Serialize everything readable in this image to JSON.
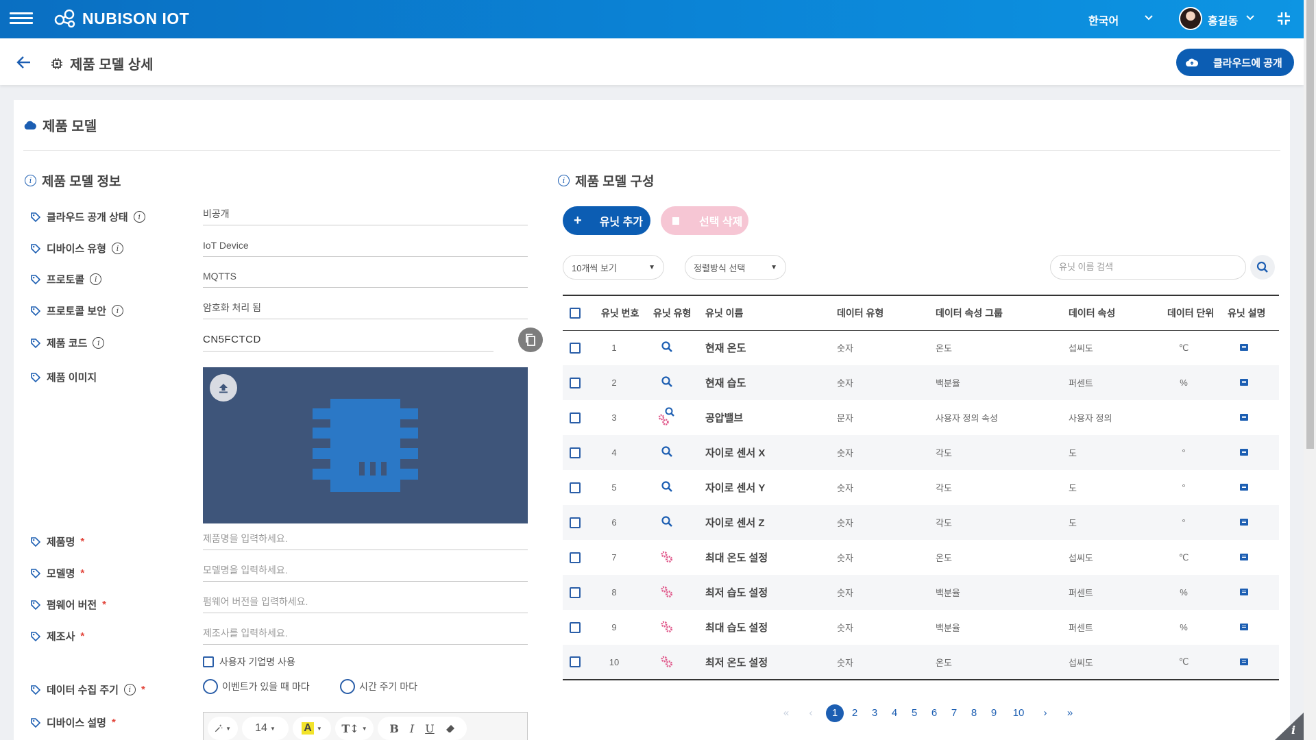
{
  "app": {
    "logo_text": "NUBISON IOT",
    "language": "한국어",
    "user_name": "홍길동"
  },
  "header": {
    "title": "제품 모델 상세",
    "publish_label": "클라우드에 공개"
  },
  "card": {
    "title": "제품 모델"
  },
  "info_section": {
    "title": "제품 모델 정보",
    "fields": [
      {
        "label": "클라우드 공개 상태",
        "value": "비공개"
      },
      {
        "label": "디바이스 유형",
        "value": "IoT Device"
      },
      {
        "label": "프로토콜",
        "value": "MQTTS"
      },
      {
        "label": "프로토콜 보안",
        "value": "암호화 처리 됨"
      },
      {
        "label": "제품 코드",
        "value": "CN5FCTCD"
      },
      {
        "label": "제품 이미지"
      },
      {
        "label": "제품명",
        "required": "*",
        "placeholder": "제품명을 입력하세요."
      },
      {
        "label": "모델명",
        "required": "*",
        "placeholder": "모델명을 입력하세요."
      },
      {
        "label": "펌웨어 버전",
        "required": "*",
        "placeholder": "펌웨어 버전을 입력하세요."
      },
      {
        "label": "제조사",
        "required": "*",
        "placeholder": "제조사를 입력하세요."
      },
      {
        "label": "데이터 수집 주기",
        "required": "*"
      },
      {
        "label": "디바이스 설명",
        "required": "*"
      }
    ],
    "custom_company_label": "사용자 기업명 사용",
    "radio_event": "이벤트가 있을 때 마다",
    "radio_time": "시간 주기 마다",
    "editor_font_size": "14"
  },
  "config_section": {
    "title": "제품 모델 구성",
    "add_unit_label": "유닛 추가",
    "delete_selected_label": "선택 삭제",
    "page_size_label": "10개씩 보기",
    "sort_label": "정렬방식 선택",
    "search_placeholder": "유닛 이름 검색",
    "columns": [
      "유닛 번호",
      "유닛 유형",
      "유닛 이름",
      "데이터 유형",
      "데이터 속성 그룹",
      "데이터 속성",
      "데이터 단위",
      "유닛 설명"
    ],
    "rows": [
      {
        "no": "1",
        "type_icon": "sensor",
        "name": "현재 온도",
        "data_type": "숫자",
        "group": "온도",
        "attr": "섭씨도",
        "unit": "℃"
      },
      {
        "no": "2",
        "type_icon": "sensor",
        "name": "현재 습도",
        "data_type": "숫자",
        "group": "백분율",
        "attr": "퍼센트",
        "unit": "%"
      },
      {
        "no": "3",
        "type_icon": "sensor-actuator",
        "name": "공압밸브",
        "data_type": "문자",
        "group": "사용자 정의 속성",
        "attr": "사용자 정의",
        "unit": ""
      },
      {
        "no": "4",
        "type_icon": "sensor",
        "name": "자이로 센서 X",
        "data_type": "숫자",
        "group": "각도",
        "attr": "도",
        "unit": "°"
      },
      {
        "no": "5",
        "type_icon": "sensor",
        "name": "자이로 센서 Y",
        "data_type": "숫자",
        "group": "각도",
        "attr": "도",
        "unit": "°"
      },
      {
        "no": "6",
        "type_icon": "sensor",
        "name": "자이로 센서 Z",
        "data_type": "숫자",
        "group": "각도",
        "attr": "도",
        "unit": "°"
      },
      {
        "no": "7",
        "type_icon": "actuator",
        "name": "최대 온도 설정",
        "data_type": "숫자",
        "group": "온도",
        "attr": "섭씨도",
        "unit": "℃"
      },
      {
        "no": "8",
        "type_icon": "actuator",
        "name": "최저 습도 설정",
        "data_type": "숫자",
        "group": "백분율",
        "attr": "퍼센트",
        "unit": "%"
      },
      {
        "no": "9",
        "type_icon": "actuator",
        "name": "최대 습도 설정",
        "data_type": "숫자",
        "group": "백분율",
        "attr": "퍼센트",
        "unit": "%"
      },
      {
        "no": "10",
        "type_icon": "actuator",
        "name": "최저 온도 설정",
        "data_type": "숫자",
        "group": "온도",
        "attr": "섭씨도",
        "unit": "℃"
      }
    ],
    "pagination": {
      "first": "«",
      "prev": "‹",
      "pages": [
        "1",
        "2",
        "3",
        "4",
        "5",
        "6",
        "7",
        "8",
        "9",
        "10"
      ],
      "current": "1",
      "next": "›",
      "last": "»"
    }
  },
  "colors": {
    "primary": "#0c5db3",
    "topbar": "#0b84d6",
    "danger_soft": "#f6c6d4",
    "required": "#e2463c",
    "actuator_icon": "#e0578a"
  }
}
